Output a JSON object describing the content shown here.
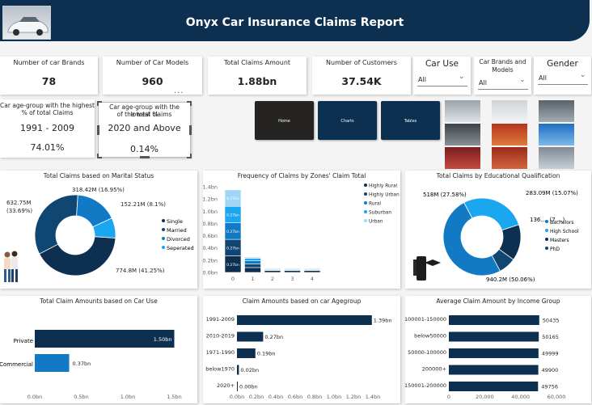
{
  "report": {
    "title": "Onyx Car Insurance Claims Report"
  },
  "kpis": [
    {
      "label": "Number of car Brands",
      "value": "78"
    },
    {
      "label": "Number of Car Models",
      "value": "960"
    },
    {
      "label": "Total Claims Amount",
      "value": "1.88bn"
    },
    {
      "label": "Number of Customers",
      "value": "37.54K"
    }
  ],
  "slicers": [
    {
      "title": "Car Use",
      "selected": "All"
    },
    {
      "title_line1": "Car Brands and",
      "title_line2": "Models",
      "selected": "All"
    },
    {
      "title": "Gender",
      "selected": "All"
    }
  ],
  "age_highest": {
    "label_line1": "Car age-group with the highest",
    "label_line2": "% of total Claims",
    "group": "1991 - 2009",
    "percent": "74.01%"
  },
  "age_lowest": {
    "label_line1": "Car age-group with the lowest %",
    "label_line2": "of the total claims",
    "group": "2020 and Above",
    "percent": "0.14%"
  },
  "more_options": "...",
  "nav": {
    "home": "Home",
    "charts": "Charts",
    "tables": "Tables"
  },
  "colors": {
    "navy": "#0d3050",
    "dark": "#0f4672",
    "mid": "#127ac4",
    "bright": "#1ba7f0",
    "pale": "#9fd6f6",
    "shadow": "#c8c8c8"
  },
  "marital_chart": {
    "title": "Total Claims based on Marital Status",
    "labels": {
      "single": "774.8M (41.25%)",
      "married_line1": "632.75M",
      "married_line2": "(33.69%)",
      "divorced": "318.42M (16.95%)",
      "separated": "152.21M (8.1%)"
    },
    "legend": [
      "Single",
      "Married",
      "Divorced",
      "Seperated"
    ]
  },
  "zones_chart": {
    "title": "Frequency of Claims by Zones' Claim Total",
    "y_ticks": [
      "0.0bn",
      "0.2bn",
      "0.4bn",
      "0.6bn",
      "0.8bn",
      "1.0bn",
      "1.2bn",
      "1.4bn"
    ],
    "x_ticks": [
      "0",
      "1",
      "2",
      "3",
      "4"
    ],
    "segment_label": "0.27bn",
    "legend": [
      "Highly Rural",
      "Highly Urban",
      "Rural",
      "Suburban",
      "Urban"
    ]
  },
  "education_chart": {
    "title": "Total Claims by Educational Qualification",
    "labels": {
      "bachelors": "940.2M (50.06%)",
      "high_school": "518M (27.58%)",
      "masters": "283.09M (15.07%)",
      "phd": "136.... (7....)"
    },
    "legend": [
      "Bachelors",
      "High School",
      "Masters",
      "PhD"
    ]
  },
  "car_use_chart": {
    "title": "Total Claim Amounts based on Car Use",
    "x_ticks": [
      "0.0bn",
      "0.5bn",
      "1.0bn",
      "1.5bn"
    ],
    "private_label": "Private",
    "private_value": "1.50bn",
    "commercial_label": "Commercial",
    "commercial_value": "0.37bn"
  },
  "agegroup_chart": {
    "title": "Claim Amounts based on car Agegroup",
    "x_ticks": [
      "0.0bn",
      "0.2bn",
      "0.4bn",
      "0.6bn",
      "0.8bn",
      "1.0bn",
      "1.2bn",
      "1.4bn"
    ]
  },
  "income_chart": {
    "title": "Average Claim Amount by Income Group",
    "x_ticks": [
      "0",
      "20,000",
      "40,000",
      "60,000"
    ]
  },
  "chart_data": [
    {
      "type": "pie",
      "title": "Total Claims based on Marital Status",
      "categories": [
        "Single",
        "Married",
        "Divorced",
        "Seperated"
      ],
      "values": [
        774.8,
        632.75,
        318.42,
        152.21
      ],
      "percent": [
        41.25,
        33.69,
        16.95,
        8.1
      ],
      "donut": true,
      "legend": "right"
    },
    {
      "type": "bar",
      "stacked": true,
      "title": "Frequency of Claims by Zones' Claim Total",
      "categories": [
        "0",
        "1",
        "2",
        "3",
        "4"
      ],
      "ylim": [
        0,
        1.4
      ],
      "series": [
        {
          "name": "Highly Rural",
          "values": [
            0.27,
            0.08,
            0.03,
            0.03,
            0.03
          ]
        },
        {
          "name": "Highly Urban",
          "values": [
            0.27,
            0.06,
            0.01,
            0.01,
            0.01
          ]
        },
        {
          "name": "Rural",
          "values": [
            0.27,
            0.05,
            0.01,
            0.01,
            0.01
          ]
        },
        {
          "name": "Suburban",
          "values": [
            0.27,
            0.04,
            0.01,
            0.01,
            0.01
          ]
        },
        {
          "name": "Urban",
          "values": [
            0.27,
            0.02,
            0.0,
            0.0,
            0.0
          ]
        }
      ],
      "legend": "right"
    },
    {
      "type": "pie",
      "title": "Total Claims by Educational Qualification",
      "categories": [
        "Bachelors",
        "High School",
        "Masters",
        "PhD"
      ],
      "values": [
        940.2,
        518,
        283.09,
        136
      ],
      "percent": [
        50.06,
        27.58,
        15.07,
        7.24
      ],
      "donut": true,
      "legend": "right"
    },
    {
      "type": "bar",
      "orientation": "horizontal",
      "title": "Total Claim Amounts based on Car Use",
      "categories": [
        "Private",
        "Commercial"
      ],
      "values": [
        1.5,
        0.37
      ],
      "value_labels": [
        "1.50bn",
        "0.37bn"
      ],
      "xlim": [
        0,
        1.6
      ]
    },
    {
      "type": "bar",
      "orientation": "horizontal",
      "title": "Claim Amounts based on car Agegroup",
      "categories": [
        "1991-2009",
        "2010-2019",
        "1971-1990",
        "below1970",
        "2020+"
      ],
      "values": [
        1.39,
        0.27,
        0.19,
        0.02,
        0.0
      ],
      "value_labels": [
        "1.39bn",
        "0.27bn",
        "0.19bn",
        "0.02bn",
        "0.00bn"
      ],
      "xlim": [
        0,
        1.4
      ]
    },
    {
      "type": "bar",
      "orientation": "horizontal",
      "title": "Average Claim Amount by Income Group",
      "categories": [
        "100001-150000",
        "below50000",
        "50000-100000",
        "200000+",
        "150001-200000"
      ],
      "values": [
        50435,
        50165,
        49999,
        49900,
        49756
      ],
      "value_labels": [
        "50435",
        "50165",
        "49999",
        "49900",
        "49756"
      ],
      "xlim": [
        0,
        60000
      ]
    }
  ]
}
